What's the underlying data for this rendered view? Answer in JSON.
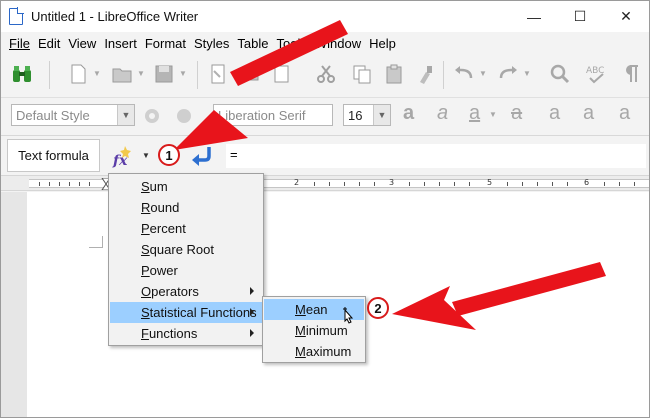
{
  "window": {
    "title": "Untitled 1 - LibreOffice Writer",
    "minimize_glyph": "—",
    "maximize_glyph": "☐",
    "close_glyph": "✕"
  },
  "menubar": {
    "items": [
      "File",
      "Edit",
      "View",
      "Insert",
      "Format",
      "Styles",
      "Table",
      "Tools",
      "Window",
      "Help"
    ]
  },
  "format_toolbar": {
    "paragraph_style": "Default Style",
    "font_name": "Liberation Serif",
    "font_size": "16"
  },
  "formula_bar": {
    "label": "Text formula",
    "formula_value": "="
  },
  "ruler": {
    "numbers": [
      "1",
      "2",
      "3",
      "4",
      "5",
      "6",
      "7"
    ]
  },
  "formula_menu": {
    "items": [
      {
        "accel": "S",
        "rest": "um",
        "submenu": false
      },
      {
        "accel": "R",
        "rest": "ound",
        "submenu": false
      },
      {
        "accel": "P",
        "rest": "ercent",
        "submenu": false
      },
      {
        "accel": "S",
        "rest": "quare Root",
        "submenu": false
      },
      {
        "accel": "P",
        "rest": "ower",
        "submenu": false
      },
      {
        "accel": "O",
        "rest": "perators",
        "submenu": true
      },
      {
        "accel": "S",
        "rest": "tatistical Functions",
        "submenu": true,
        "selected": true
      },
      {
        "accel": "F",
        "rest": "unctions",
        "submenu": true
      }
    ]
  },
  "statistical_submenu": {
    "items": [
      {
        "accel": "M",
        "rest": "ean",
        "selected": true
      },
      {
        "accel": "M",
        "rest": "inimum",
        "selected": false
      },
      {
        "accel": "M",
        "rest": "aximum",
        "selected": false
      }
    ]
  },
  "annotations": {
    "badge1": "1",
    "badge2": "2",
    "arrow_color": "#e8141b"
  }
}
